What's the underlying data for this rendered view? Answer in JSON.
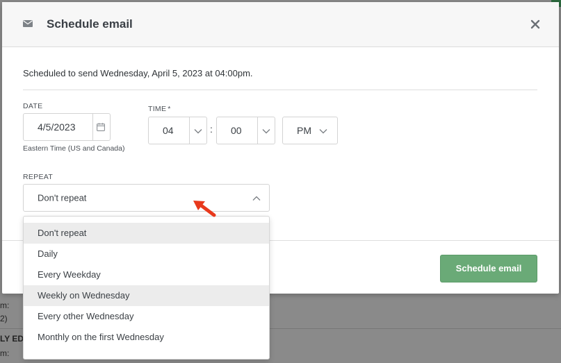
{
  "background": {
    "fragments": [
      "m:",
      "2)",
      "LY ED",
      "m:"
    ]
  },
  "modal": {
    "title": "Schedule email",
    "summary": "Scheduled to send Wednesday, April 5, 2023 at 04:00pm.",
    "date": {
      "label": "DATE",
      "value": "4/5/2023",
      "timezone": "Eastern Time (US and Canada)"
    },
    "time": {
      "label": "TIME",
      "required_mark": "*",
      "hour": "04",
      "minute": "00",
      "separator": ":",
      "period": "PM"
    },
    "repeat": {
      "label": "REPEAT",
      "selected": "Don't repeat",
      "options": [
        "Don't repeat",
        "Daily",
        "Every Weekday",
        "Weekly on Wednesday",
        "Every other Wednesday",
        "Monthly on the first Wednesday"
      ]
    },
    "primary_button": "Schedule email"
  },
  "colors": {
    "primary_button": "#6aaa77",
    "annotation_arrow": "#e8391c"
  },
  "icons": {
    "header": "envelope-icon",
    "close": "close-icon",
    "date": "calendar-icon",
    "select": "chevron-down-icon",
    "repeat_open": "chevron-up-icon",
    "annotation": "red-arrow-icon"
  }
}
